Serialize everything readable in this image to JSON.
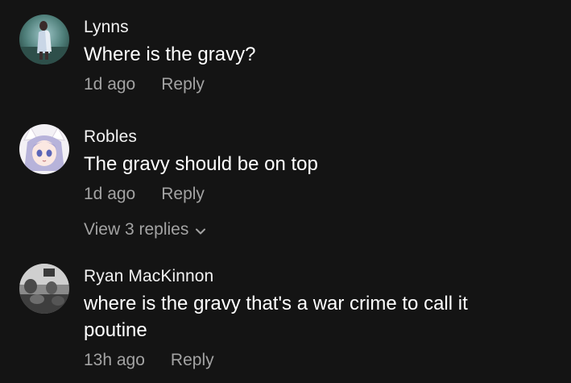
{
  "comments": [
    {
      "username": "Lynns",
      "text": "Where is the gravy?",
      "time": "1d ago",
      "reply_label": "Reply",
      "avatar_icon": "lynns-avatar"
    },
    {
      "username": "Robles",
      "text": "The gravy should be on top",
      "time": "1d ago",
      "reply_label": "Reply",
      "view_replies_label": "View 3 replies",
      "avatar_icon": "robles-avatar"
    },
    {
      "username": "Ryan MacKinnon",
      "text": "where is the gravy that's a war crime to call it poutine",
      "time": "13h ago",
      "reply_label": "Reply",
      "avatar_icon": "ryan-avatar"
    }
  ],
  "colors": {
    "background": "#141414",
    "primary_text": "#ffffff",
    "secondary_text": "#a3a3a3"
  }
}
